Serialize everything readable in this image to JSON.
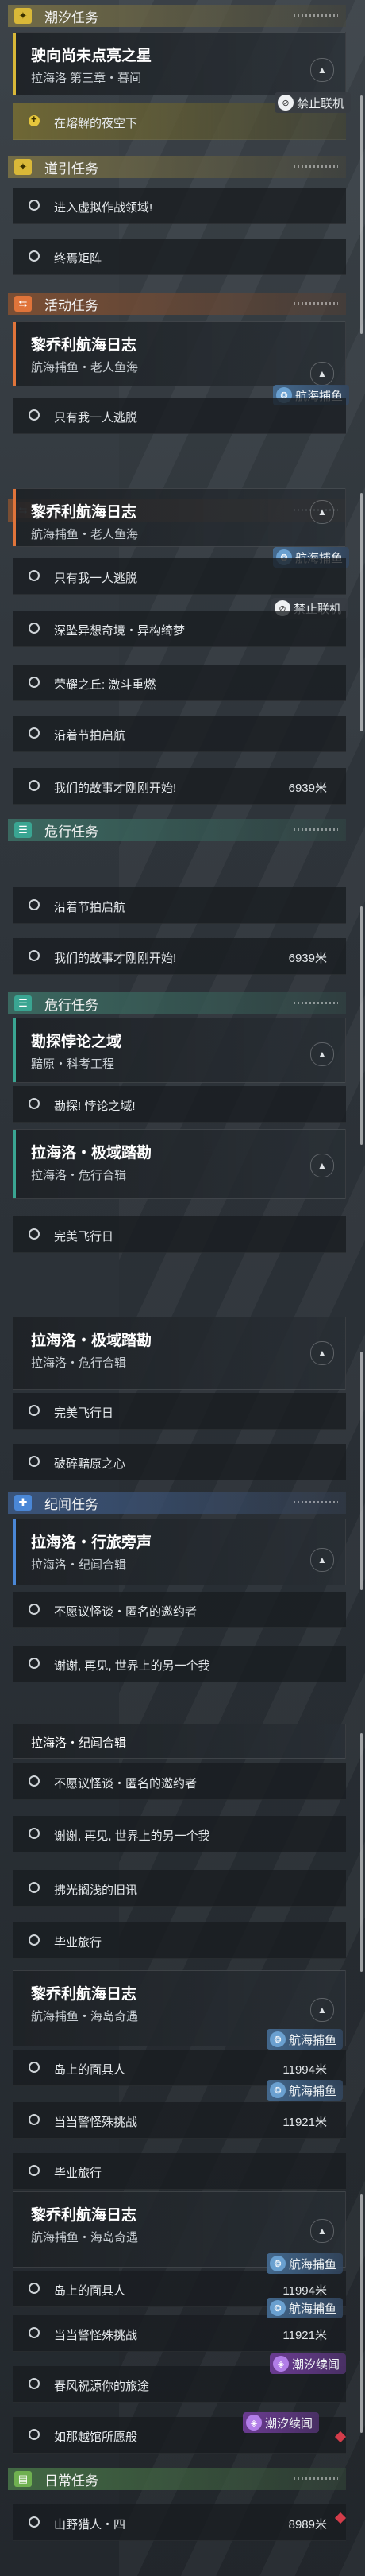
{
  "app": "任务列表",
  "text": {
    "cat_tide": "潮汐任务",
    "tide_title": "驶向尚未点亮之星",
    "tide_sub": "拉海洛 第三章・暮间",
    "tide_step": "在熔解的夜空下",
    "badge_ban": "禁止联机",
    "cat_guide": "道引任务",
    "guide_1": "进入虚拟作战领域!",
    "guide_2": "终焉矩阵",
    "cat_activity": "活动任务",
    "act_title": "黎乔利航海日志",
    "act_sub": "航海捕鱼・老人鱼海",
    "act_partial": "只有我一人逃脱",
    "badge_fish": "航海捕鱼",
    "act_1": "只有我一人逃脱",
    "act_2": "深坠异想奇境・异构绮梦",
    "act_3": "荣耀之丘: 激斗重燃",
    "act_4": "沿着节拍启航",
    "act_5": "我们的故事才刚刚开始!",
    "dist_6939": "6939米",
    "cat_danger": "危行任务",
    "danger_title": "勘探悖论之域",
    "danger_sub": "黯原・科考工程",
    "danger_1": "勘探! 悖论之域!",
    "polar_title": "拉海洛・极域踏勘",
    "polar_sub": "拉海洛・危行合辑",
    "polar_1": "完美飞行日",
    "polar_2": "破碎黯原之心",
    "cat_record": "纪闻任务",
    "record_title": "拉海洛・行旅旁声",
    "record_sub": "拉海洛・纪闻合辑",
    "record_1": "不愿议怪谈・匿名的邀约者",
    "record_2": "谢谢, 再见, 世界上的另一个我",
    "record_3": "拂光搁浅的旧讯",
    "record_4": "毕业旅行",
    "voy_title": "黎乔利航海日志",
    "voy_sub": "航海捕鱼・海岛奇遇",
    "voy_1": "岛上的面具人",
    "dist_11994": "11994米",
    "voy_2": "当当警怪殊挑战",
    "dist_11921": "11921米",
    "voy_3": "春风祝源你的旅途",
    "voy_4": "如那越馆所愿般",
    "badge_tide": "潮汐续闻",
    "cat_daily": "日常任务",
    "daily_1": "山野猎人・四",
    "dist_8989": "8989米"
  }
}
